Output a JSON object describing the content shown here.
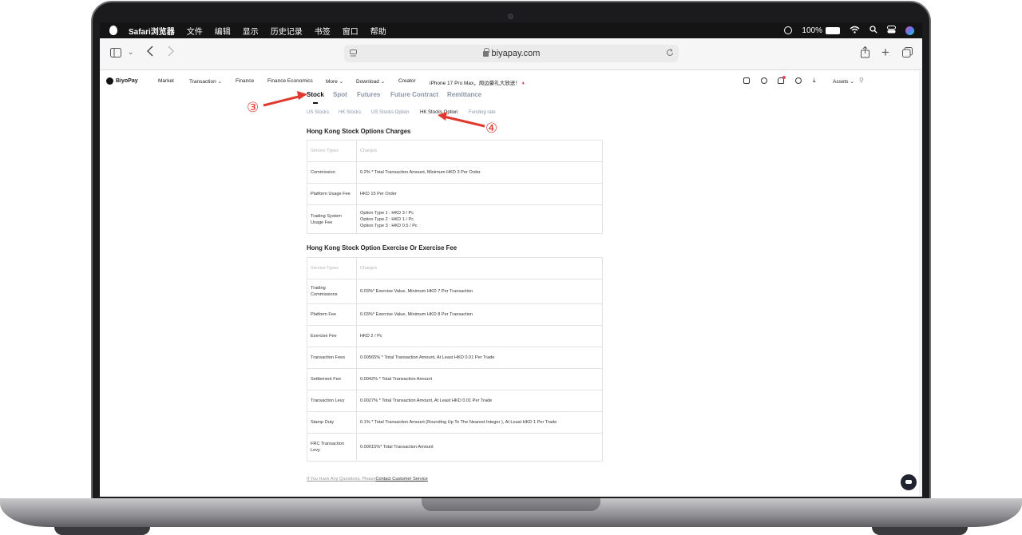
{
  "menubar": {
    "app": "Safari浏览器",
    "items": [
      "文件",
      "编辑",
      "显示",
      "历史记录",
      "书签",
      "窗口",
      "帮助"
    ],
    "battery": "100%"
  },
  "browser": {
    "url": "biyapay.com"
  },
  "site": {
    "logo": "BiyoPay",
    "nav": [
      "Market",
      "Transaction",
      "Finance",
      "Finance Economics",
      "More",
      "Download",
      "Creator"
    ],
    "promo": "iPhone 17 Pro Max，周边豪礼大放送！",
    "assets": "Assets",
    "main_tabs": [
      "Stock",
      "Spot",
      "Futures",
      "Future Contract",
      "Remittance"
    ],
    "sub_tabs": [
      "US Stocks",
      "HK Stocks",
      "US Stocks Option",
      "HK Stocks Option",
      "Funding rate"
    ]
  },
  "section1": {
    "title": "Hong Kong Stock Options Charges",
    "header": [
      "Service Types",
      "Charges"
    ],
    "rows": [
      [
        "Commission",
        "0.2% * Total Transaction Amount, Minimum HKD 3 Per Order"
      ],
      [
        "Platform Usage Fee",
        "HKD 15 Per Order"
      ],
      [
        "Trading System\nUsage Fee",
        "Option Type 1 : HKD 3 / Pc\nOption Type 2 : HKD 1 / Pc\nOption Type 3 : HKD 0.5 / Pc"
      ]
    ]
  },
  "section2": {
    "title": "Hong Kong Stock Option Exercise Or Exercise Fee",
    "header": [
      "Service Types",
      "Charges"
    ],
    "rows": [
      [
        "Trading\nCommissions",
        "0.03%* Exercise Value, Minimum HKD 7 Per Transaction"
      ],
      [
        "Platform Fee",
        "0.03%* Exercise Value, Minimum HKD 8 Per Transaction"
      ],
      [
        "Exercise Fee",
        "HKD 2 / Pc"
      ],
      [
        "Transaction Fees",
        "0.00565% * Total Transaction Amount, At Least HKD 0.01 Per Trade"
      ],
      [
        "Settlement Fee",
        "0.0042% * Total Transaction Amount"
      ],
      [
        "Transaction Levy",
        "0.0027% * Total Transaction Amount, At Least HKD 0.01 Per Trade"
      ],
      [
        "Stamp Duty",
        "0.1% * Total Transaction Amount (Rounding Up To The Nearest Integer ), At Least HKD 1 Per Trade"
      ],
      [
        "FRC Transaction\nLevy",
        "0.00015%* Total Transaction Amount"
      ]
    ]
  },
  "footer": {
    "prefix": "If You Have Any Questions, Please",
    "link": "Contact Customer Service"
  },
  "annotations": {
    "step3": "③",
    "step4": "④",
    "color": "#e03a2f"
  }
}
